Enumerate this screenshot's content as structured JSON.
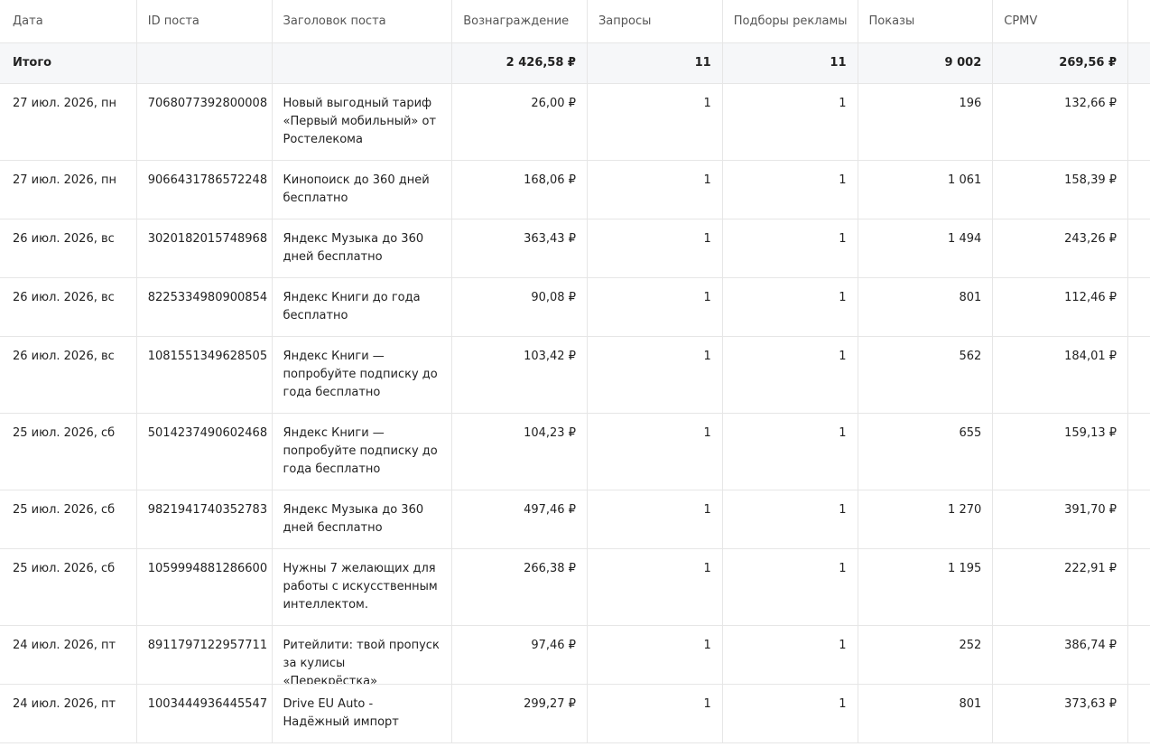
{
  "columns": {
    "date": "Дата",
    "post_id": "ID поста",
    "title": "Заголовок поста",
    "reward": "Вознаграждение",
    "requests": "Запросы",
    "ad_matches": "Подборы рекламы",
    "impressions": "Показы",
    "cpmv": "CPMV"
  },
  "total": {
    "label": "Итого",
    "reward": "2 426,58 ₽",
    "requests": "11",
    "ad_matches": "11",
    "impressions": "9 002",
    "cpmv": "269,56 ₽"
  },
  "rows": [
    {
      "date": "27 июл. 2026, пн",
      "post_id": "7068077392800008",
      "title": "Новый выгодный тариф «Первый мобильный» от Ростелекома",
      "reward": "26,00 ₽",
      "requests": "1",
      "ad_matches": "1",
      "impressions": "196",
      "cpmv": "132,66 ₽"
    },
    {
      "date": "27 июл. 2026, пн",
      "post_id": "9066431786572248",
      "title": "Кинопоиск до 360 дней бесплатно",
      "reward": "168,06 ₽",
      "requests": "1",
      "ad_matches": "1",
      "impressions": "1 061",
      "cpmv": "158,39 ₽"
    },
    {
      "date": "26 июл. 2026, вс",
      "post_id": "3020182015748968",
      "title": "Яндекс Музыка до 360 дней бесплатно",
      "reward": "363,43 ₽",
      "requests": "1",
      "ad_matches": "1",
      "impressions": "1 494",
      "cpmv": "243,26 ₽"
    },
    {
      "date": "26 июл. 2026, вс",
      "post_id": "8225334980900854",
      "title": "Яндекс Книги до года бесплатно",
      "reward": "90,08 ₽",
      "requests": "1",
      "ad_matches": "1",
      "impressions": "801",
      "cpmv": "112,46 ₽"
    },
    {
      "date": "26 июл. 2026, вс",
      "post_id": "1081551349628505",
      "title": "Яндекс Книги — попробуйте подписку до года бесплатно",
      "reward": "103,42 ₽",
      "requests": "1",
      "ad_matches": "1",
      "impressions": "562",
      "cpmv": "184,01 ₽"
    },
    {
      "date": "25 июл. 2026, сб",
      "post_id": "5014237490602468",
      "title": "Яндекс Книги — попробуйте подписку до года бесплатно",
      "reward": "104,23 ₽",
      "requests": "1",
      "ad_matches": "1",
      "impressions": "655",
      "cpmv": "159,13 ₽"
    },
    {
      "date": "25 июл. 2026, сб",
      "post_id": "9821941740352783",
      "title": "Яндекс Музыка до 360 дней бесплатно",
      "reward": "497,46 ₽",
      "requests": "1",
      "ad_matches": "1",
      "impressions": "1 270",
      "cpmv": "391,70 ₽"
    },
    {
      "date": "25 июл. 2026, сб",
      "post_id": "1059994881286600",
      "title": "Нужны 7 желающих для работы с искусственным интеллектом.",
      "reward": "266,38 ₽",
      "requests": "1",
      "ad_matches": "1",
      "impressions": "1 195",
      "cpmv": "222,91 ₽"
    },
    {
      "date": "24 июл. 2026, пт",
      "post_id": "8911797122957711",
      "title": "Ритейлити: твой пропуск за кулисы «Перекрёстка»",
      "reward": "97,46 ₽",
      "requests": "1",
      "ad_matches": "1",
      "impressions": "252",
      "cpmv": "386,74 ₽"
    },
    {
      "date": "24 июл. 2026, пт",
      "post_id": "1003444936445547",
      "title": "Drive EU Auto - Надёжный импорт",
      "reward": "299,27 ₽",
      "requests": "1",
      "ad_matches": "1",
      "impressions": "801",
      "cpmv": "373,63 ₽"
    }
  ]
}
